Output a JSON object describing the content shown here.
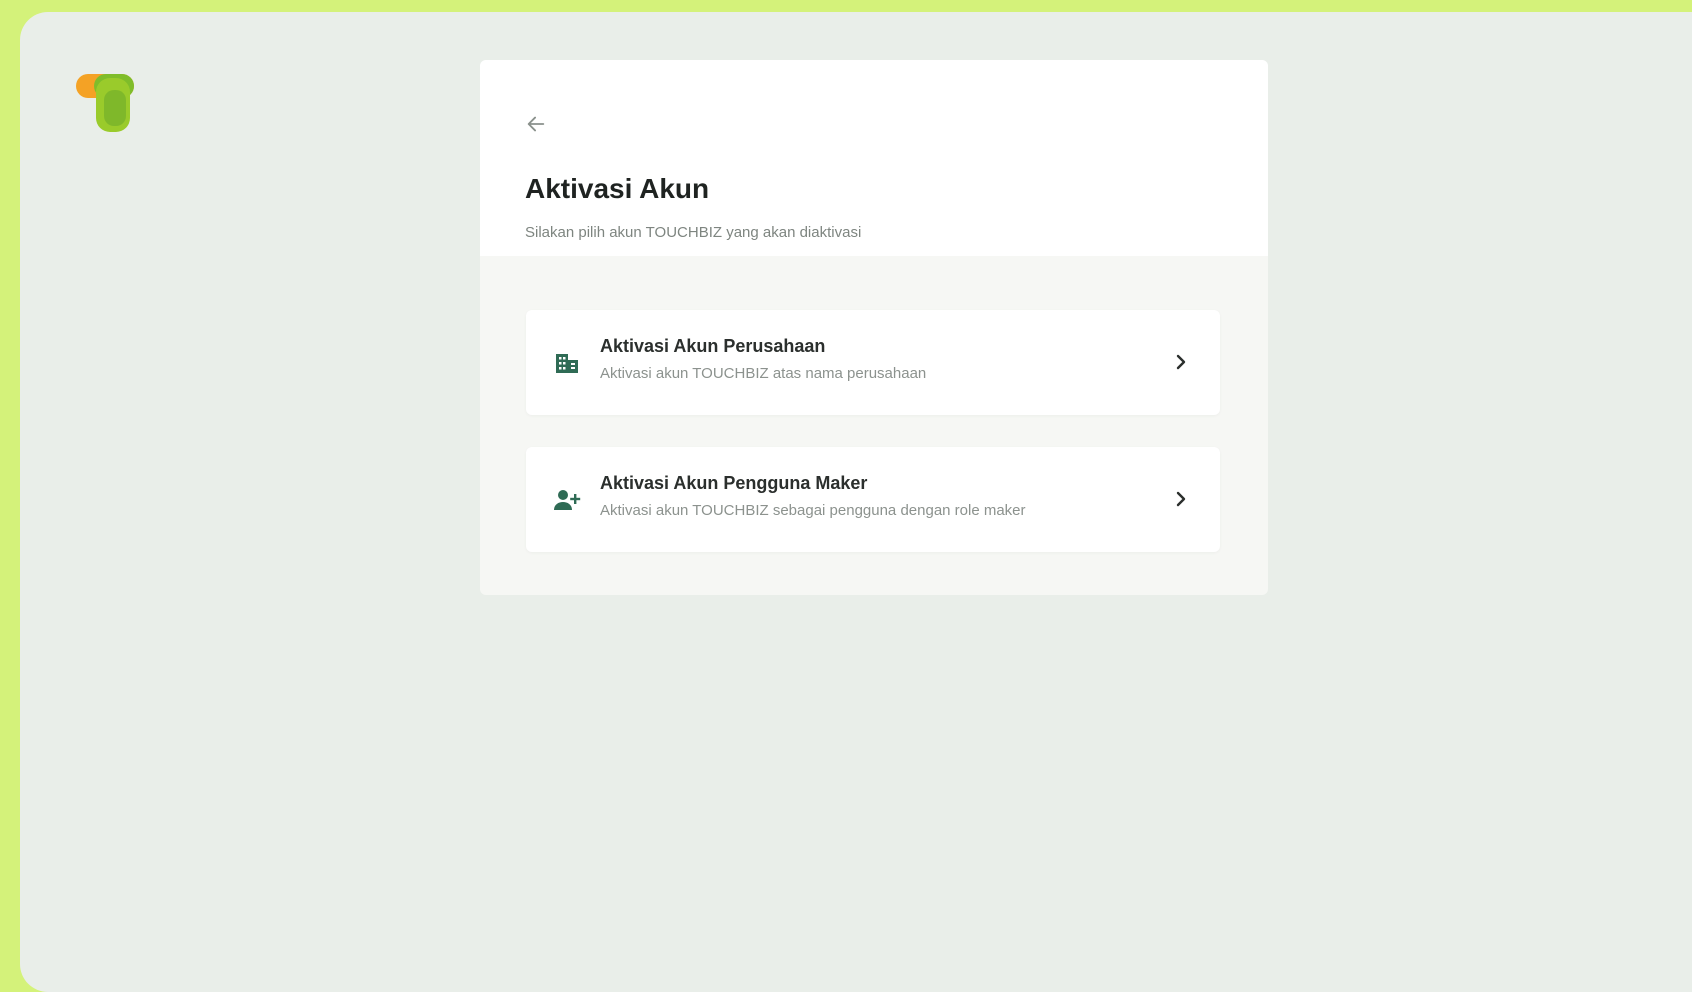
{
  "page": {
    "title": "Aktivasi Akun",
    "subtitle": "Silakan pilih akun TOUCHBIZ yang akan diaktivasi"
  },
  "icons": {
    "logo": "touchbiz-logo",
    "back": "arrow-left-icon",
    "company": "building-icon",
    "maker": "user-plus-icon",
    "chevron": "chevron-right-icon"
  },
  "colors": {
    "accent_green": "#2f6b55",
    "logo_orange": "#f4a225",
    "logo_green": "#9acb2b",
    "background_lime": "#d4f27a"
  },
  "options": [
    {
      "title": "Aktivasi Akun Perusahaan",
      "description": "Aktivasi akun TOUCHBIZ atas nama perusahaan"
    },
    {
      "title": "Aktivasi Akun Pengguna Maker",
      "description": "Aktivasi akun TOUCHBIZ sebagai pengguna dengan role maker"
    }
  ]
}
